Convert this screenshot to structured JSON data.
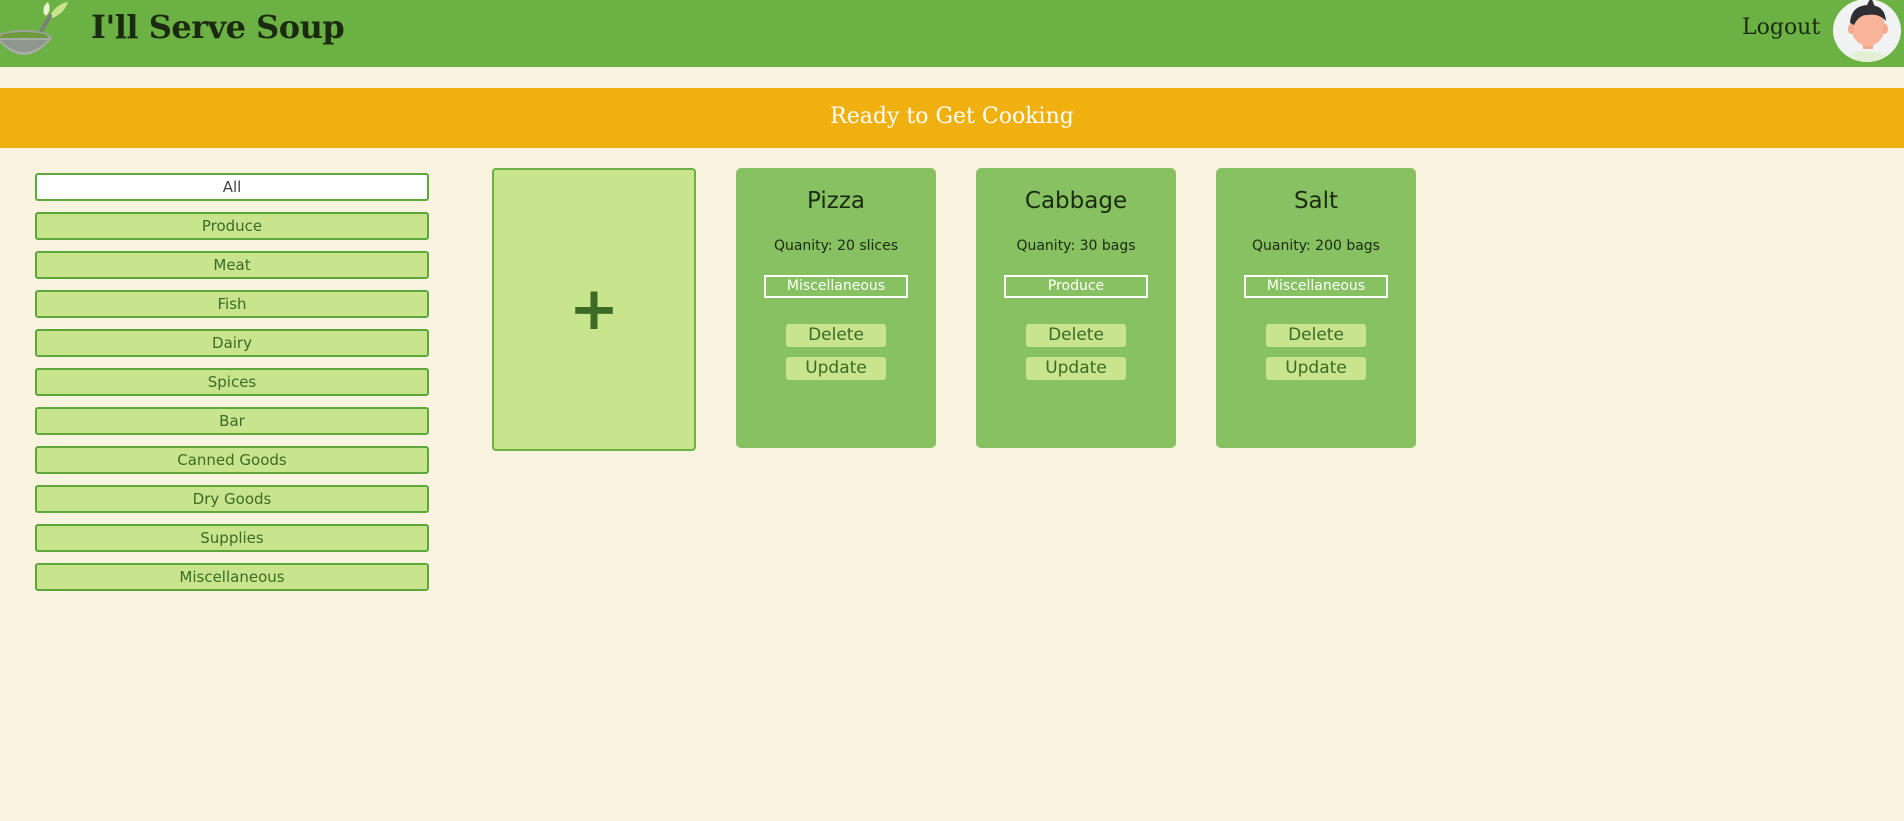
{
  "header": {
    "app_title": "I'll Serve Soup",
    "logout_label": "Logout",
    "logo_icon": "soup-bowl-icon",
    "avatar_icon": "user-avatar-icon"
  },
  "banner": {
    "text": "Ready to Get Cooking"
  },
  "sidebar": {
    "categories": [
      {
        "label": "All",
        "active": true
      },
      {
        "label": "Produce"
      },
      {
        "label": "Meat"
      },
      {
        "label": "Fish"
      },
      {
        "label": "Dairy"
      },
      {
        "label": "Spices"
      },
      {
        "label": "Bar"
      },
      {
        "label": "Canned Goods"
      },
      {
        "label": "Dry Goods"
      },
      {
        "label": "Supplies"
      },
      {
        "label": "Miscellaneous"
      }
    ]
  },
  "add_card": {
    "symbol": "+"
  },
  "items": [
    {
      "name": "Pizza",
      "quantity": "Quanity: 20 slices",
      "category": "Miscellaneous",
      "delete_label": "Delete",
      "update_label": "Update"
    },
    {
      "name": "Cabbage",
      "quantity": "Quanity: 30 bags",
      "category": "Produce",
      "delete_label": "Delete",
      "update_label": "Update"
    },
    {
      "name": "Salt",
      "quantity": "Quanity: 200 bags",
      "category": "Miscellaneous",
      "delete_label": "Delete",
      "update_label": "Update"
    }
  ],
  "colors": {
    "header_green": "#6bb143",
    "banner_amber": "#f0b00f",
    "card_green": "#87c161",
    "light_green": "#c8e48d",
    "page_bg": "#faf3e0"
  }
}
